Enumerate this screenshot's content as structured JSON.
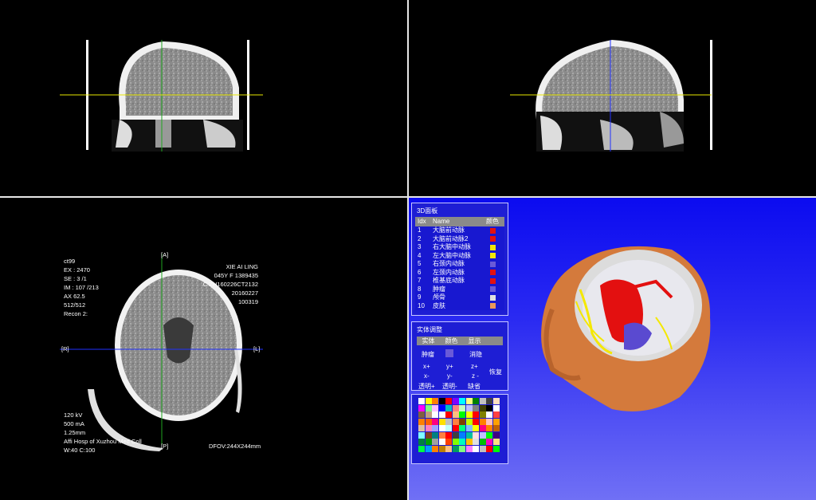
{
  "axial_overlay": {
    "top_left": [
      "ct99",
      "EX : 2470",
      "SE : 3 /1",
      "IM : 107 /213",
      "AX 62.5",
      "512/512",
      "Recon 2:"
    ],
    "top_right": [
      "XIE AI LING",
      "045Y F  1389435",
      "C ZH160226CT2132",
      "20160227",
      "100319"
    ],
    "bottom_left": [
      "120 kV",
      "500 mA",
      "1.25mm",
      "Affi Hosp of Xuzhou Med Coll",
      "W:40 C:100"
    ],
    "bottom_right": "DFOV:244X244mm",
    "orient_top": "[A]",
    "orient_bottom": "[P]",
    "orient_left": "[R]",
    "orient_right": "[L]"
  },
  "panel3d": {
    "title": "3D面板",
    "headers": {
      "idx": "Idx",
      "name": "Name",
      "color": "颜色"
    },
    "rows": [
      {
        "idx": "1",
        "name": "大脑前动脉",
        "color": "#e31010"
      },
      {
        "idx": "2",
        "name": "大脑前动脉2",
        "color": "#e31010"
      },
      {
        "idx": "3",
        "name": "右大脑中动脉",
        "color": "#f4e800"
      },
      {
        "idx": "4",
        "name": "左大脑中动脉",
        "color": "#f4e800"
      },
      {
        "idx": "5",
        "name": "右颈内动脉",
        "color": "#6a5ad8"
      },
      {
        "idx": "6",
        "name": "左颈内动脉",
        "color": "#e31010"
      },
      {
        "idx": "7",
        "name": "椎基底动脉",
        "color": "#e31010"
      },
      {
        "idx": "8",
        "name": "肿瘤",
        "color": "#6a5ad8"
      },
      {
        "idx": "9",
        "name": "颅骨",
        "color": "#e0e0e0"
      },
      {
        "idx": "10",
        "name": "皮肤",
        "color": "#e8975a"
      }
    ]
  },
  "entity_panel": {
    "title": "实体调整",
    "headers": [
      "实体",
      "颜色",
      "显示"
    ],
    "entity_name": "肿瘤",
    "entity_color": "#6a5ad8",
    "visibility": "消隐",
    "x_plus": "x+",
    "y_plus": "y+",
    "z_plus": "z+",
    "x_minus": "x-",
    "y_minus": "y-",
    "z_minus": "z -",
    "restore": "恢复",
    "opacity_plus": "透明+",
    "opacity_minus": "透明-",
    "default": "缺省"
  },
  "palette_colors": [
    "#ffffff",
    "#ffff00",
    "#ff8000",
    "#000000",
    "#ff0000",
    "#8000ff",
    "#00ffff",
    "#ffff80",
    "#008000",
    "#c0c0c0",
    "#404040",
    "#ffe0c0",
    "#ff00ff",
    "#80ff80",
    "#ffc0ff",
    "#0000ff",
    "#00c0c0",
    "#ff8080",
    "#c0ffc0",
    "#c0c0ff",
    "#808080",
    "#404000",
    "#000000",
    "#ffffff",
    "#806040",
    "#c0a080",
    "#ffffff",
    "#ffffff",
    "#ff0000",
    "#ffc080",
    "#00ff00",
    "#ffff00",
    "#ff0000",
    "#808000",
    "#ffffff",
    "#ff4040",
    "#ff8000",
    "#ff6000",
    "#ff0080",
    "#ffe000",
    "#c0c0c0",
    "#ff8040",
    "#804000",
    "#c0ff00",
    "#ff0000",
    "#ff8000",
    "#ffc0c0",
    "#ffa000",
    "#e0c0a0",
    "#ff80c0",
    "#a0a0ff",
    "#ffffff",
    "#c0ffff",
    "#ff0000",
    "#00ff80",
    "#80c0ff",
    "#ffff00",
    "#ff0080",
    "#ff8000",
    "#c06000",
    "#80ffff",
    "#804020",
    "#008080",
    "#ff8040",
    "#ff0000",
    "#404040",
    "#0080ff",
    "#00c0a0",
    "#ffe0e0",
    "#c0c0ff",
    "#00ff00",
    "#400080",
    "#008040",
    "#00a000",
    "#a0a0a0",
    "#ffffff",
    "#ff4000",
    "#80ff00",
    "#00ffc0",
    "#ffc000",
    "#e0e0e0",
    "#00c000",
    "#ff00c0",
    "#ffe080",
    "#00ff40",
    "#00a0ff",
    "#ff8000",
    "#c08000",
    "#ffc080",
    "#00a060",
    "#80ff80",
    "#ff80ff",
    "#ffffff",
    "#c0c0c0",
    "#ff0000",
    "#00ff00"
  ]
}
